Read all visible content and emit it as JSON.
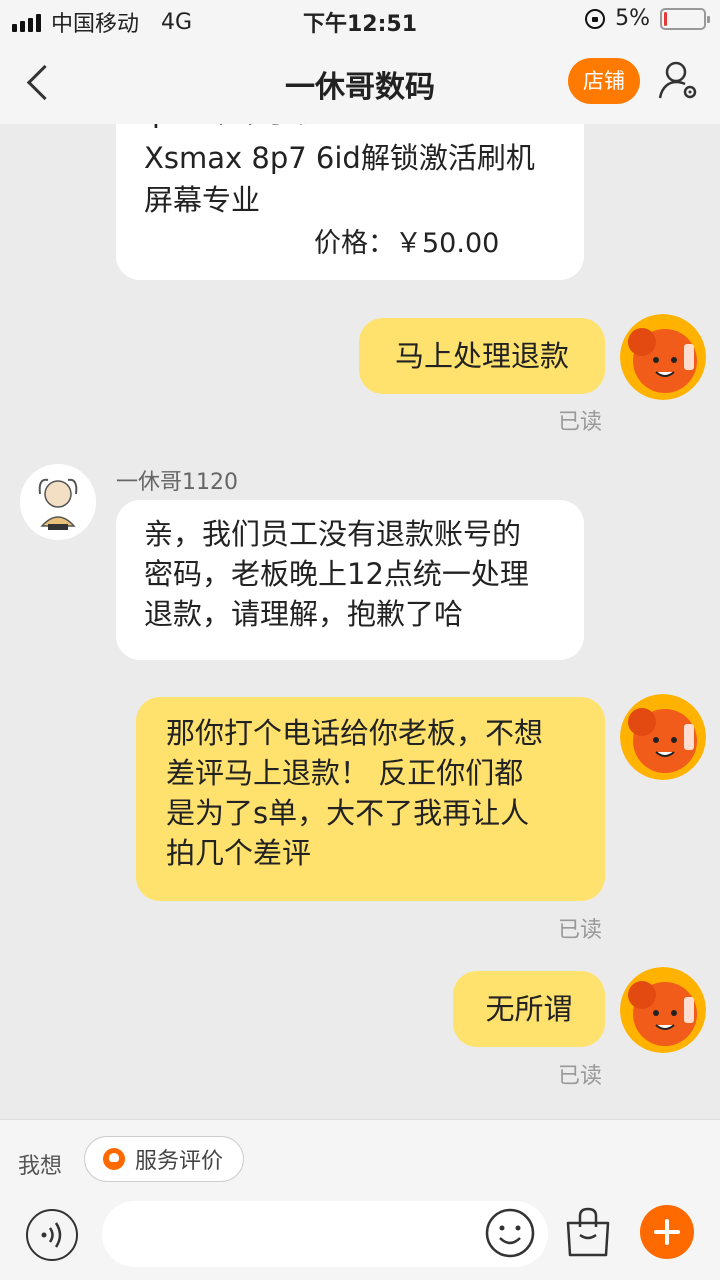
{
  "status_bar": {
    "carrier": "中国移动",
    "network": "4G",
    "time": "下午12:51",
    "battery_text": "5%",
    "battery_level": 0.05,
    "battery_color": "#e53935"
  },
  "nav": {
    "title": "一休哥数码",
    "store_label": "店铺",
    "back_icon": "chevron-left-icon",
    "profile_icon": "user-settings-icon"
  },
  "chat": {
    "product_card": {
      "title_line_partial": "ipad苹果手机iPhone xr",
      "title_line_2": "Xsmax 8p7 6id解锁激活刷机",
      "title_line_3": "屏幕专业",
      "price_label": "价格：",
      "price": "￥50.00"
    },
    "messages": [
      {
        "from": "me",
        "lines": [
          "马上处理退款"
        ],
        "status": "已读"
      },
      {
        "from": "shop",
        "sender": "一休哥1120",
        "lines": [
          "亲，我们员工没有退款账号的",
          "密码，老板晚上12点统一处理",
          "退款，请理解，抱歉了哈"
        ]
      },
      {
        "from": "me",
        "lines": [
          "那你打个电话给你老板，不想",
          "差评马上退款！ 反正你们都",
          "是为了s单，大不了我再让人",
          "拍几个差评"
        ],
        "status": "已读"
      },
      {
        "from": "me",
        "lines": [
          "无所谓"
        ],
        "status": "已读"
      }
    ]
  },
  "quick_replies": {
    "label": "我想",
    "items": [
      "服务评价"
    ]
  },
  "input_bar": {
    "placeholder": "",
    "voice_icon": "voice-icon",
    "emoji_icon": "emoji-icon",
    "bag_icon": "shopping-bag-icon",
    "plus_icon": "plus-icon"
  },
  "colors": {
    "accent": "#ff7a00",
    "my_bubble": "#ffe26e",
    "their_bubble": "#ffffff",
    "background": "#ebebeb"
  }
}
